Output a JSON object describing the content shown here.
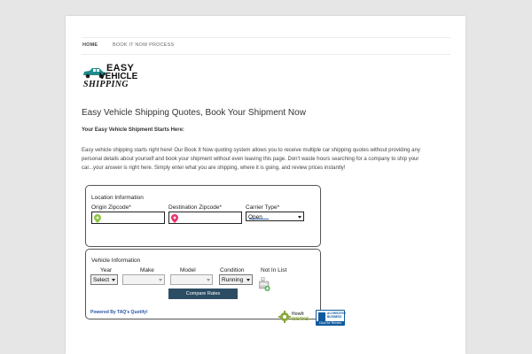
{
  "nav": {
    "items": [
      {
        "label": "HOME",
        "active": true
      },
      {
        "label": "BOOK IT NOW PROCESS",
        "active": false
      }
    ]
  },
  "logo": {
    "line1": "EASY",
    "line2": "VEHICLE",
    "line3": "SHIPPING"
  },
  "page": {
    "title": "Easy Vehicle Shipping Quotes, Book Your Shipment Now",
    "subtitle": "Your Easy Vehicle Shipment Starts Here:",
    "paragraph": [
      "Easy vehicle shipping starts right here! Our Book It Now quoting system allows you to receive multiple car shipping quotes without providing any",
      "personal details about yourself and book your shipment without even leaving this page. Don't waste hours searching for a company to ship your",
      "car...your answer is right here. Simply enter what you are shipping, where it is going, and review prices instantly!"
    ]
  },
  "location": {
    "title": "Location Information",
    "origin_label": "Origin Zipcode*",
    "origin_value": "",
    "destination_label": "Destination Zipcode*",
    "destination_value": "",
    "carrier_label": "Carrier Type*",
    "carrier_value": "Open"
  },
  "vehicle": {
    "title": "Vehicle Information",
    "year_label": "Year",
    "year_value": "Select",
    "make_label": "Make",
    "make_value": "",
    "model_label": "Model",
    "model_value": "",
    "condition_label": "Condition",
    "condition_value": "Running",
    "notinlist_label": "Not In List"
  },
  "compare_button": "Compare Rates",
  "powered_by": "Powered By TAQ's Quotify!",
  "badges": {
    "howit": [
      "HowIt",
      "WORKS"
    ],
    "bbb": [
      "ACCREDITED",
      "BUSINESS"
    ],
    "bbb_link": "Click for Review"
  },
  "colors": {
    "button": "#2c4c63",
    "link": "#2a57a8",
    "bbb": "#0f5a9e",
    "logo_car": "#1f8c8c",
    "origin_pin": "#8cc63f",
    "destination_pin": "#e8336b"
  }
}
